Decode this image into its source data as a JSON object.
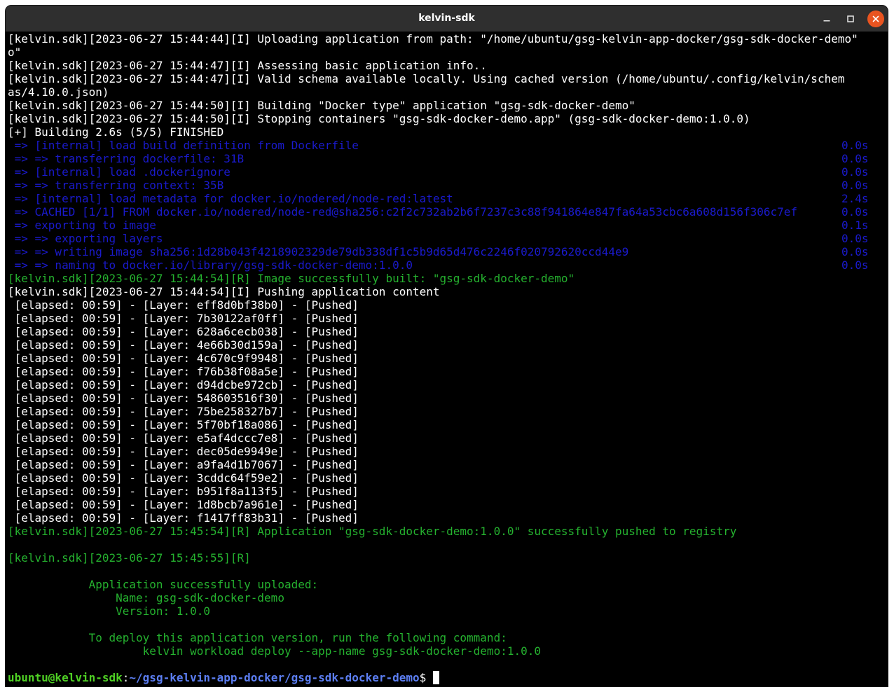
{
  "window": {
    "title": "kelvin-sdk",
    "minimize_icon": "minimize-icon",
    "maximize_icon": "maximize-icon",
    "close_icon": "close-icon",
    "close_color": "#e95420"
  },
  "terminal": {
    "log_lines": [
      "[kelvin.sdk][2023-06-27 15:44:44][I] Uploading application from path: \"/home/ubuntu/gsg-kelvin-app-docker/gsg-sdk-docker-demo\"",
      "o\"",
      "[kelvin.sdk][2023-06-27 15:44:47][I] Assessing basic application info..",
      "[kelvin.sdk][2023-06-27 15:44:47][I] Valid schema available locally. Using cached version (/home/ubuntu/.config/kelvin/schem",
      "as/4.10.0.json)",
      "[kelvin.sdk][2023-06-27 15:44:50][I] Building \"Docker type\" application \"gsg-sdk-docker-demo\"",
      "[kelvin.sdk][2023-06-27 15:44:50][I] Stopping containers \"gsg-sdk-docker-demo.app\" (gsg-sdk-docker-demo:1.0.0)",
      "[+] Building 2.6s (5/5) FINISHED"
    ],
    "build_steps": [
      {
        "text": " => [internal] load build definition from Dockerfile",
        "duration": "0.0s"
      },
      {
        "text": " => => transferring dockerfile: 31B",
        "duration": "0.0s"
      },
      {
        "text": " => [internal] load .dockerignore",
        "duration": "0.0s"
      },
      {
        "text": " => => transferring context: 35B",
        "duration": "0.0s"
      },
      {
        "text": " => [internal] load metadata for docker.io/nodered/node-red:latest",
        "duration": "2.4s"
      },
      {
        "text": " => CACHED [1/1] FROM docker.io/nodered/node-red@sha256:c2f2c732ab2b6f7237c3c88f941864e847fa64a53cbc6a608d156f306c7ef",
        "duration": "0.0s"
      },
      {
        "text": " => exporting to image",
        "duration": "0.1s"
      },
      {
        "text": " => => exporting layers",
        "duration": "0.0s"
      },
      {
        "text": " => => writing image sha256:1d28b043f4218902329de79db338df1c5b9d65d476c2246f020792620ccd44e9",
        "duration": "0.0s"
      },
      {
        "text": " => => naming to docker.io/library/gsg-sdk-docker-demo:1.0.0",
        "duration": "0.0s"
      }
    ],
    "image_built": "[kelvin.sdk][2023-06-27 15:44:54][R] Image successfully built: \"gsg-sdk-docker-demo\"",
    "pushing": "[kelvin.sdk][2023-06-27 15:44:54][I] Pushing application content",
    "layers": [
      " [elapsed: 00:59] - [Layer: eff8d0bf38b0] - [Pushed]",
      " [elapsed: 00:59] - [Layer: 7b30122af0ff] - [Pushed]",
      " [elapsed: 00:59] - [Layer: 628a6cecb038] - [Pushed]",
      " [elapsed: 00:59] - [Layer: 4e66b30d159a] - [Pushed]",
      " [elapsed: 00:59] - [Layer: 4c670c9f9948] - [Pushed]",
      " [elapsed: 00:59] - [Layer: f76b38f08a5e] - [Pushed]",
      " [elapsed: 00:59] - [Layer: d94dcbe972cb] - [Pushed]",
      " [elapsed: 00:59] - [Layer: 548603516f30] - [Pushed]",
      " [elapsed: 00:59] - [Layer: 75be258327b7] - [Pushed]",
      " [elapsed: 00:59] - [Layer: 5f70bf18a086] - [Pushed]",
      " [elapsed: 00:59] - [Layer: e5af4dccc7e8] - [Pushed]",
      " [elapsed: 00:59] - [Layer: dec05de9949e] - [Pushed]",
      " [elapsed: 00:59] - [Layer: a9fa4d1b7067] - [Pushed]",
      " [elapsed: 00:59] - [Layer: 3cddc64f59e2] - [Pushed]",
      " [elapsed: 00:59] - [Layer: b951f8a113f5] - [Pushed]",
      " [elapsed: 00:59] - [Layer: 1d8bcb7a961e] - [Pushed]",
      " [elapsed: 00:59] - [Layer: f1417ff83b31] - [Pushed]"
    ],
    "pushed": "[kelvin.sdk][2023-06-27 15:45:54][R] Application \"gsg-sdk-docker-demo:1.0.0\" successfully pushed to registry",
    "result_header": "[kelvin.sdk][2023-06-27 15:45:55][R]",
    "summary": {
      "uploaded": "            Application successfully uploaded:",
      "name": "                Name: gsg-sdk-docker-demo",
      "version": "                Version: 1.0.0",
      "deploy_hint": "            To deploy this application version, run the following command:",
      "deploy_command": "                    kelvin workload deploy --app-name gsg-sdk-docker-demo:1.0.0"
    },
    "prompt": {
      "user_host": "ubuntu@kelvin-sdk",
      "separator": ":",
      "path": "~/gsg-kelvin-app-docker/gsg-sdk-docker-demo",
      "symbol": "$ "
    },
    "colors": {
      "background": "#000000",
      "text": "#ffffff",
      "build_blue": "#1a1acc",
      "success_green": "#25b22f",
      "prompt_user": "#4fd024",
      "prompt_path": "#5c7ef2"
    }
  }
}
